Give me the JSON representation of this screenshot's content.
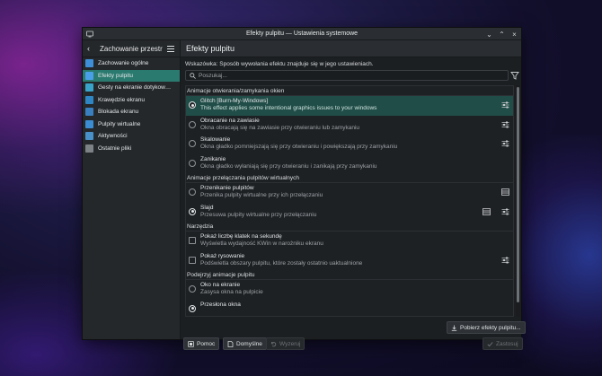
{
  "window": {
    "title": "Efekty pulpitu — Ustawienia systemowe"
  },
  "sidebar": {
    "header": "Zachowanie przestr…",
    "items": [
      {
        "label": "Zachowanie ogólne",
        "color": "#3f8fd8"
      },
      {
        "label": "Efekty pulpitu",
        "color": "#4aa0e8",
        "selected": true
      },
      {
        "label": "Gesty na ekranie dotykow…",
        "color": "#39a3c9"
      },
      {
        "label": "Krawędzie ekranu",
        "color": "#2f86c4"
      },
      {
        "label": "Blokada ekranu",
        "color": "#3a7fc0"
      },
      {
        "label": "Pulpity wirtualne",
        "color": "#3b8cd0"
      },
      {
        "label": "Aktywności",
        "color": "#4a90c8"
      },
      {
        "label": "Ostatnie pliki",
        "color": "#7d8287"
      }
    ]
  },
  "main": {
    "title": "Efekty pulpitu",
    "hint": "Wskazówka: Sposób wywołania efektu znajduje się w jego ustawieniach.",
    "search_placeholder": "Poszukaj...",
    "sections": [
      {
        "title": "Animacje otwierania/zamykania okien",
        "rows": [
          {
            "name": "Glitch [Burn-My-Windows]",
            "desc": "This effect applies some intentional graphics issues to your windows",
            "type": "radio",
            "checked": true,
            "selected": true,
            "config": true,
            "video": false
          },
          {
            "name": "Obracanie na zawiasie",
            "desc": "Okna obracają się na zawiasie przy otwieraniu lub zamykaniu",
            "type": "radio",
            "checked": false,
            "selected": false,
            "config": true,
            "video": false
          },
          {
            "name": "Skalowanie",
            "desc": "Okna gładko pomniejszają się przy otwieraniu i powiększają przy zamykaniu",
            "type": "radio",
            "checked": false,
            "selected": false,
            "config": true,
            "video": false
          },
          {
            "name": "Zanikanie",
            "desc": "Okna gładko wyłaniają się przy otwieraniu i zanikają przy zamykaniu",
            "type": "radio",
            "checked": false,
            "selected": false,
            "config": false,
            "video": false
          }
        ]
      },
      {
        "title": "Animacje przełączania pulpitów wirtualnych",
        "rows": [
          {
            "name": "Przenikanie pulpitów",
            "desc": "Przenika pulpity wirtualne przy ich przełączaniu",
            "type": "radio",
            "checked": false,
            "selected": false,
            "config": false,
            "video": true
          },
          {
            "name": "Slajd",
            "desc": "Przesuwa pulpity wirtualne przy przełączaniu",
            "type": "radio",
            "checked": true,
            "selected": false,
            "config": true,
            "video": true
          }
        ]
      },
      {
        "title": "Narzędzia",
        "rows": [
          {
            "name": "Pokaż liczbę klatek na sekundę",
            "desc": "Wyświetla wydajność KWin w narożniku ekranu",
            "type": "check",
            "checked": false,
            "selected": false,
            "config": false,
            "video": false
          },
          {
            "name": "Pokaż rysowanie",
            "desc": "Podświetla obszary pulpitu, które zostały ostatnio uaktualnione",
            "type": "check",
            "checked": false,
            "selected": false,
            "config": true,
            "video": false
          }
        ]
      },
      {
        "title": "Podejrzyj animacje pulpitu",
        "rows": [
          {
            "name": "Oko na ekranie",
            "desc": "Zasysa okna na pulpicie",
            "type": "radio",
            "checked": false,
            "selected": false,
            "config": false,
            "video": false
          },
          {
            "name": "Przesłona okna",
            "desc": "",
            "type": "radio",
            "checked": true,
            "selected": false,
            "config": false,
            "video": false
          }
        ]
      }
    ],
    "get_new_button": "Pobierz efekty pulpitu...",
    "help_button": "Pomoc",
    "defaults_button": "Domyślne",
    "reset_button": "Wyzeruj",
    "apply_button": "Zastosuj"
  }
}
